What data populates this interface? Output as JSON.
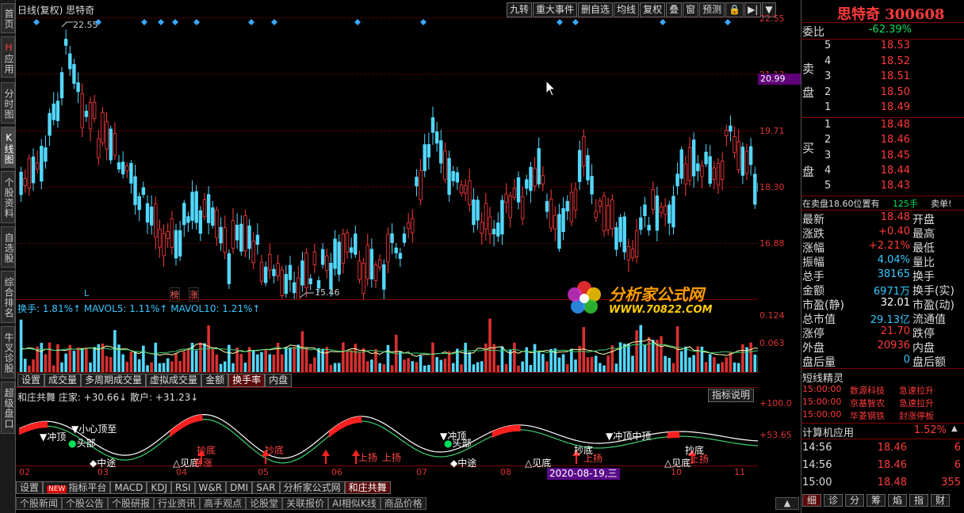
{
  "sidebar": {
    "tabs": [
      {
        "label": "首页"
      },
      {
        "label": "应用"
      },
      {
        "label": "分时图"
      },
      {
        "label": "K线图"
      },
      {
        "label": "个股资料"
      },
      {
        "label": "自选股"
      },
      {
        "label": "综合排名"
      },
      {
        "label": "牛叉诊股"
      },
      {
        "label": "超级盘口"
      }
    ]
  },
  "chart": {
    "title": "日线(复权)  思特奇",
    "toolbar": [
      "九转",
      "重大事件",
      "删自选",
      "均线",
      "复权",
      "叠",
      "窗",
      "预测"
    ],
    "price_ticks": [
      "22.55",
      "21.13",
      "19.71",
      "18.30",
      "16.88"
    ],
    "current_price_tag": "20.99",
    "high_label": "22.55",
    "low_label": "15.46",
    "marks": [
      "L",
      "榜",
      "涨"
    ],
    "vol_title": "换手: 1.81%↑ MAVOL5: 1.11%↑ MAVOL10: 1.21%↑",
    "vol_ticks": [
      "0.124",
      "0.063"
    ],
    "indicator_tabs": [
      "设置",
      "成交量",
      "多周期成交量",
      "虚拟成交量",
      "金额",
      "换手率",
      "内盘"
    ],
    "active_indicator_tab": "换手率",
    "zj_title": "和庄共舞 庄家: +30.66↓ 散户: +31.23↓",
    "explain_label": "指标说明",
    "zj_ticks": [
      "+100.0",
      "+53.65"
    ],
    "zj_annotations": [
      "冲顶",
      "小心顶至",
      "头部",
      "抄底",
      "见底",
      "暴涨",
      "抄底",
      "上扬",
      "上扬",
      "冲顶",
      "头部",
      "中途",
      "中途",
      "见底",
      "见底",
      "抄底",
      "冲顶中顶",
      "上扬",
      "抄底",
      "上扬"
    ],
    "x_labels": [
      "02",
      "03",
      "04",
      "05",
      "06",
      "07",
      "08",
      "09",
      "10",
      "11"
    ],
    "date_tip": "2020-08-19,三",
    "bottom_tabs": [
      "设置",
      "指标平台",
      "MACD",
      "KDJ",
      "RSI",
      "W&R",
      "DMI",
      "SAR",
      "分析家公式网",
      "和庄共舞"
    ],
    "bottom_new_badge": "NEW",
    "active_bottom_tab": "和庄共舞",
    "news_tabs": [
      "个股新闻",
      "个股公告",
      "个股研报",
      "行业资讯",
      "高手观点",
      "论股堂",
      "关联报价",
      "AI相似K线",
      "商品价格"
    ]
  },
  "watermark": {
    "line1": "分析家公式网",
    "line2": "WWW.70822.COM"
  },
  "quote": {
    "stock_name": "思特奇",
    "stock_code": "300608",
    "weibi_label": "委比",
    "weibi_value": "-62.39%",
    "sell_label": "卖盘",
    "buy_label": "买盘",
    "sell": [
      {
        "lvl": "5",
        "price": "18.53"
      },
      {
        "lvl": "4",
        "price": "18.52"
      },
      {
        "lvl": "3",
        "price": "18.51"
      },
      {
        "lvl": "2",
        "price": "18.50"
      },
      {
        "lvl": "1",
        "price": "18.49"
      }
    ],
    "buy": [
      {
        "lvl": "1",
        "price": "18.48"
      },
      {
        "lvl": "2",
        "price": "18.46"
      },
      {
        "lvl": "3",
        "price": "18.45"
      },
      {
        "lvl": "4",
        "price": "18.44"
      },
      {
        "lvl": "5",
        "price": "18.43"
      }
    ],
    "alert_text": "在卖盘18.60位置有",
    "alert_qty": "125手",
    "alert_type": "卖单!",
    "stats": [
      {
        "l": "最新",
        "v": "18.48",
        "c": "red",
        "r": "开盘"
      },
      {
        "l": "涨跌",
        "v": "+0.40",
        "c": "red",
        "r": "最高"
      },
      {
        "l": "涨幅",
        "v": "+2.21%",
        "c": "red",
        "r": "最低"
      },
      {
        "l": "振幅",
        "v": "4.04%",
        "c": "cyan",
        "r": "量比"
      },
      {
        "l": "总手",
        "v": "38165",
        "c": "cyan",
        "r": "换手"
      },
      {
        "l": "金额",
        "v": "6971万",
        "c": "cyan",
        "r": "换手(实)"
      },
      {
        "l": "市盈(静)",
        "v": "32.01",
        "c": "white",
        "r": "市盈(动)"
      },
      {
        "l": "总市值",
        "v": "29.13亿",
        "c": "cyan",
        "r": "流通值"
      },
      {
        "l": "涨停",
        "v": "21.70",
        "c": "red",
        "r": "跌停"
      },
      {
        "l": "外盘",
        "v": "20936",
        "c": "red",
        "r": "内盘"
      },
      {
        "l": "盘后量",
        "v": "0",
        "c": "cyan",
        "r": "盘后额"
      }
    ],
    "elf_title": "短线精灵",
    "elf": [
      {
        "t": "15:00:00",
        "n": "数源科技",
        "e": "急速拉升"
      },
      {
        "t": "15:00:00",
        "n": "京基智农",
        "e": "急速拉升"
      },
      {
        "t": "15:00:00",
        "n": "华菱钢铁",
        "e": "封涨停板"
      }
    ],
    "sector_name": "计算机应用",
    "sector_pct": "1.52%",
    "ticks": [
      {
        "t": "14:56",
        "p": "18.46",
        "v": "6"
      },
      {
        "t": "14:56",
        "p": "18.46",
        "v": "6"
      },
      {
        "t": "15:00",
        "p": "18.48",
        "v": "355"
      }
    ],
    "bottom_tabs": [
      "细",
      "诊",
      "分",
      "筹",
      "焰",
      "指",
      "财"
    ]
  }
}
